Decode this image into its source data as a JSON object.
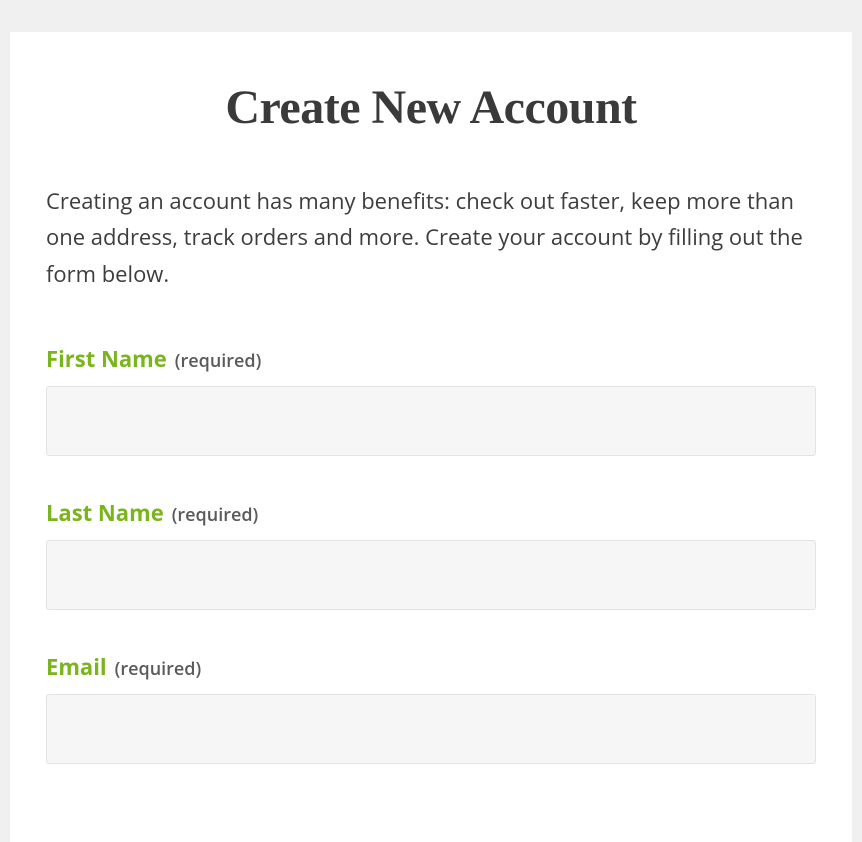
{
  "heading": "Create New Account",
  "intro": "Creating an account has many benefits: check out faster, keep more than one address, track orders and more. Create your account by filling out the form below.",
  "fields": {
    "first_name": {
      "label": "First Name",
      "required_text": "(required)",
      "value": ""
    },
    "last_name": {
      "label": "Last Name",
      "required_text": "(required)",
      "value": ""
    },
    "email": {
      "label": "Email",
      "required_text": "(required)",
      "value": ""
    }
  }
}
